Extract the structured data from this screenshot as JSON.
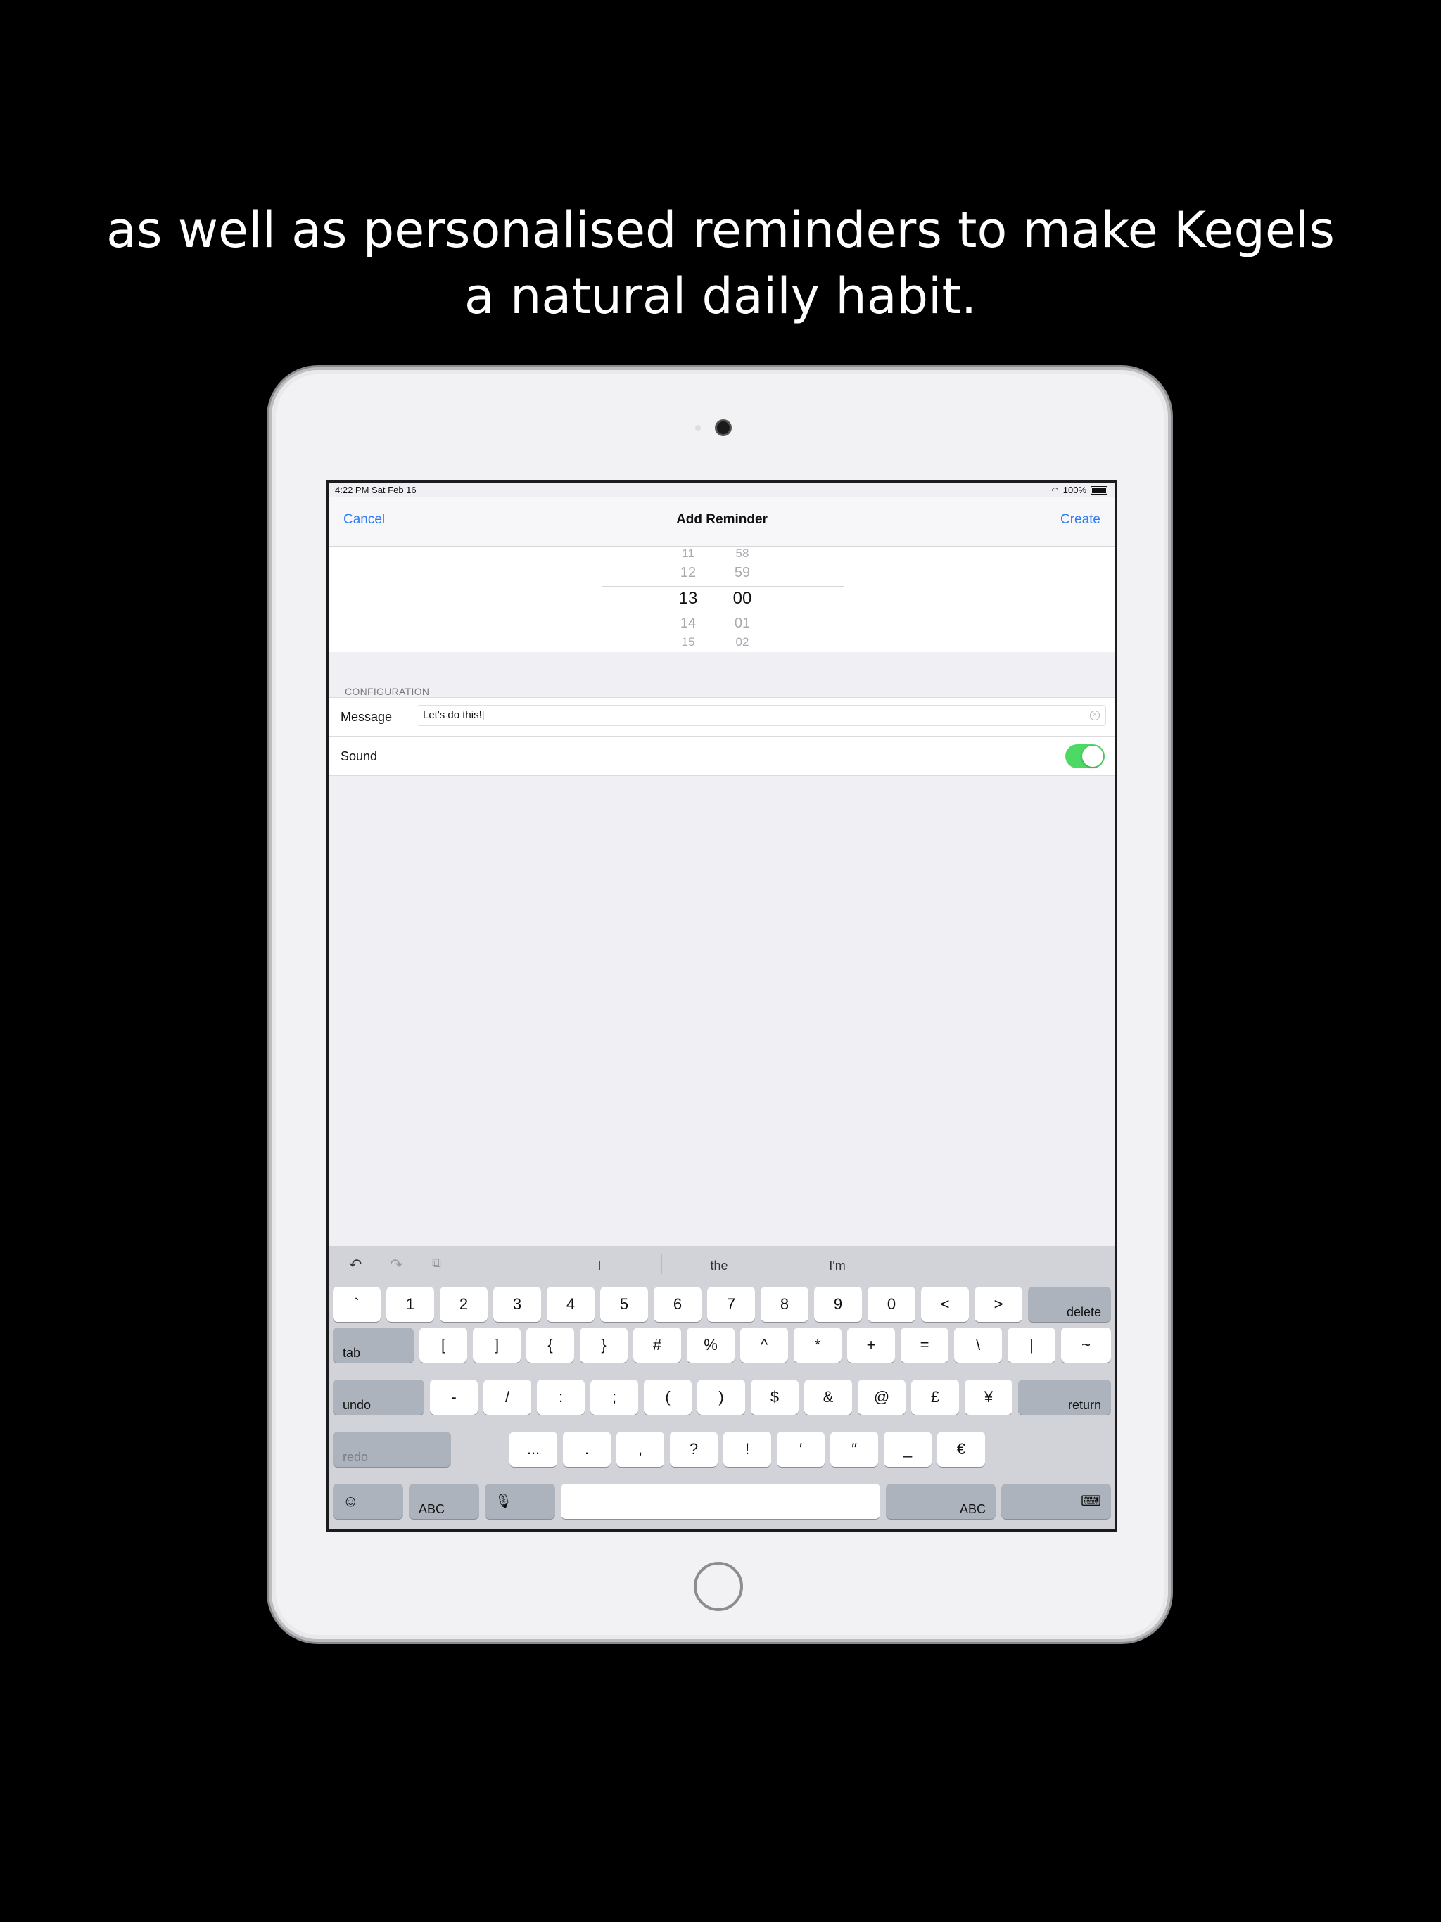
{
  "caption": {
    "line1": "as well as personalised reminders to make Kegels",
    "line2": "a natural daily habit."
  },
  "status_bar": {
    "time": "4:22 PM   Sat Feb 16",
    "battery": "100%"
  },
  "nav": {
    "cancel": "Cancel",
    "title": "Add Reminder",
    "create": "Create"
  },
  "picker": {
    "hours": [
      "11",
      "12",
      "13",
      "14",
      "15"
    ],
    "minutes": [
      "58",
      "59",
      "00",
      "01",
      "02"
    ],
    "selected_hour": "13",
    "selected_minute": "00"
  },
  "configuration": {
    "header": "CONFIGURATION",
    "message_label": "Message",
    "message_value": "Let's do this!",
    "sound_label": "Sound",
    "sound_on": true,
    "toggle_color": "#4cd964"
  },
  "keyboard": {
    "suggestions": [
      "I",
      "the",
      "I'm"
    ],
    "row1": [
      "`",
      "1",
      "2",
      "3",
      "4",
      "5",
      "6",
      "7",
      "8",
      "9",
      "0",
      "<",
      ">"
    ],
    "delete": "delete",
    "tab": "tab",
    "row2": [
      "[",
      "]",
      "{",
      "}",
      "#",
      "%",
      "^",
      "*",
      "+",
      "=",
      "\\",
      "|",
      "~"
    ],
    "undo": "undo",
    "row3": [
      "-",
      "/",
      ":",
      ";",
      "(",
      ")",
      "$",
      "&",
      "@",
      "£",
      "¥"
    ],
    "return": "return",
    "redo": "redo",
    "row4": [
      "...",
      ".",
      ",",
      "?",
      "!",
      "′",
      "″",
      "_",
      "€"
    ],
    "abc_left": "ABC",
    "abc_right": "ABC"
  },
  "colors": {
    "accent": "#2e7cf6",
    "toggle_on": "#4cd964"
  }
}
